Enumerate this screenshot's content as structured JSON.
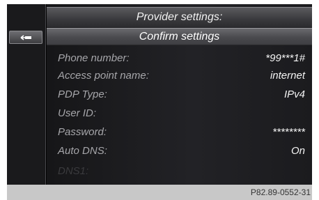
{
  "header": {
    "title": "Provider settings:"
  },
  "confirm": {
    "label": "Confirm settings"
  },
  "back_button": {
    "icon": "back-arrow-icon"
  },
  "rows": [
    {
      "label": "Phone number:",
      "value": "*99***1#"
    },
    {
      "label": "Access point name:",
      "value": "internet"
    },
    {
      "label": "PDP Type:",
      "value": "IPv4"
    },
    {
      "label": "User ID:",
      "value": ""
    },
    {
      "label": "Password:",
      "value": "********"
    },
    {
      "label": "Auto DNS:",
      "value": "On"
    },
    {
      "label": "DNS1:",
      "value": ""
    }
  ],
  "figure_code": "P82.89-0552-31"
}
